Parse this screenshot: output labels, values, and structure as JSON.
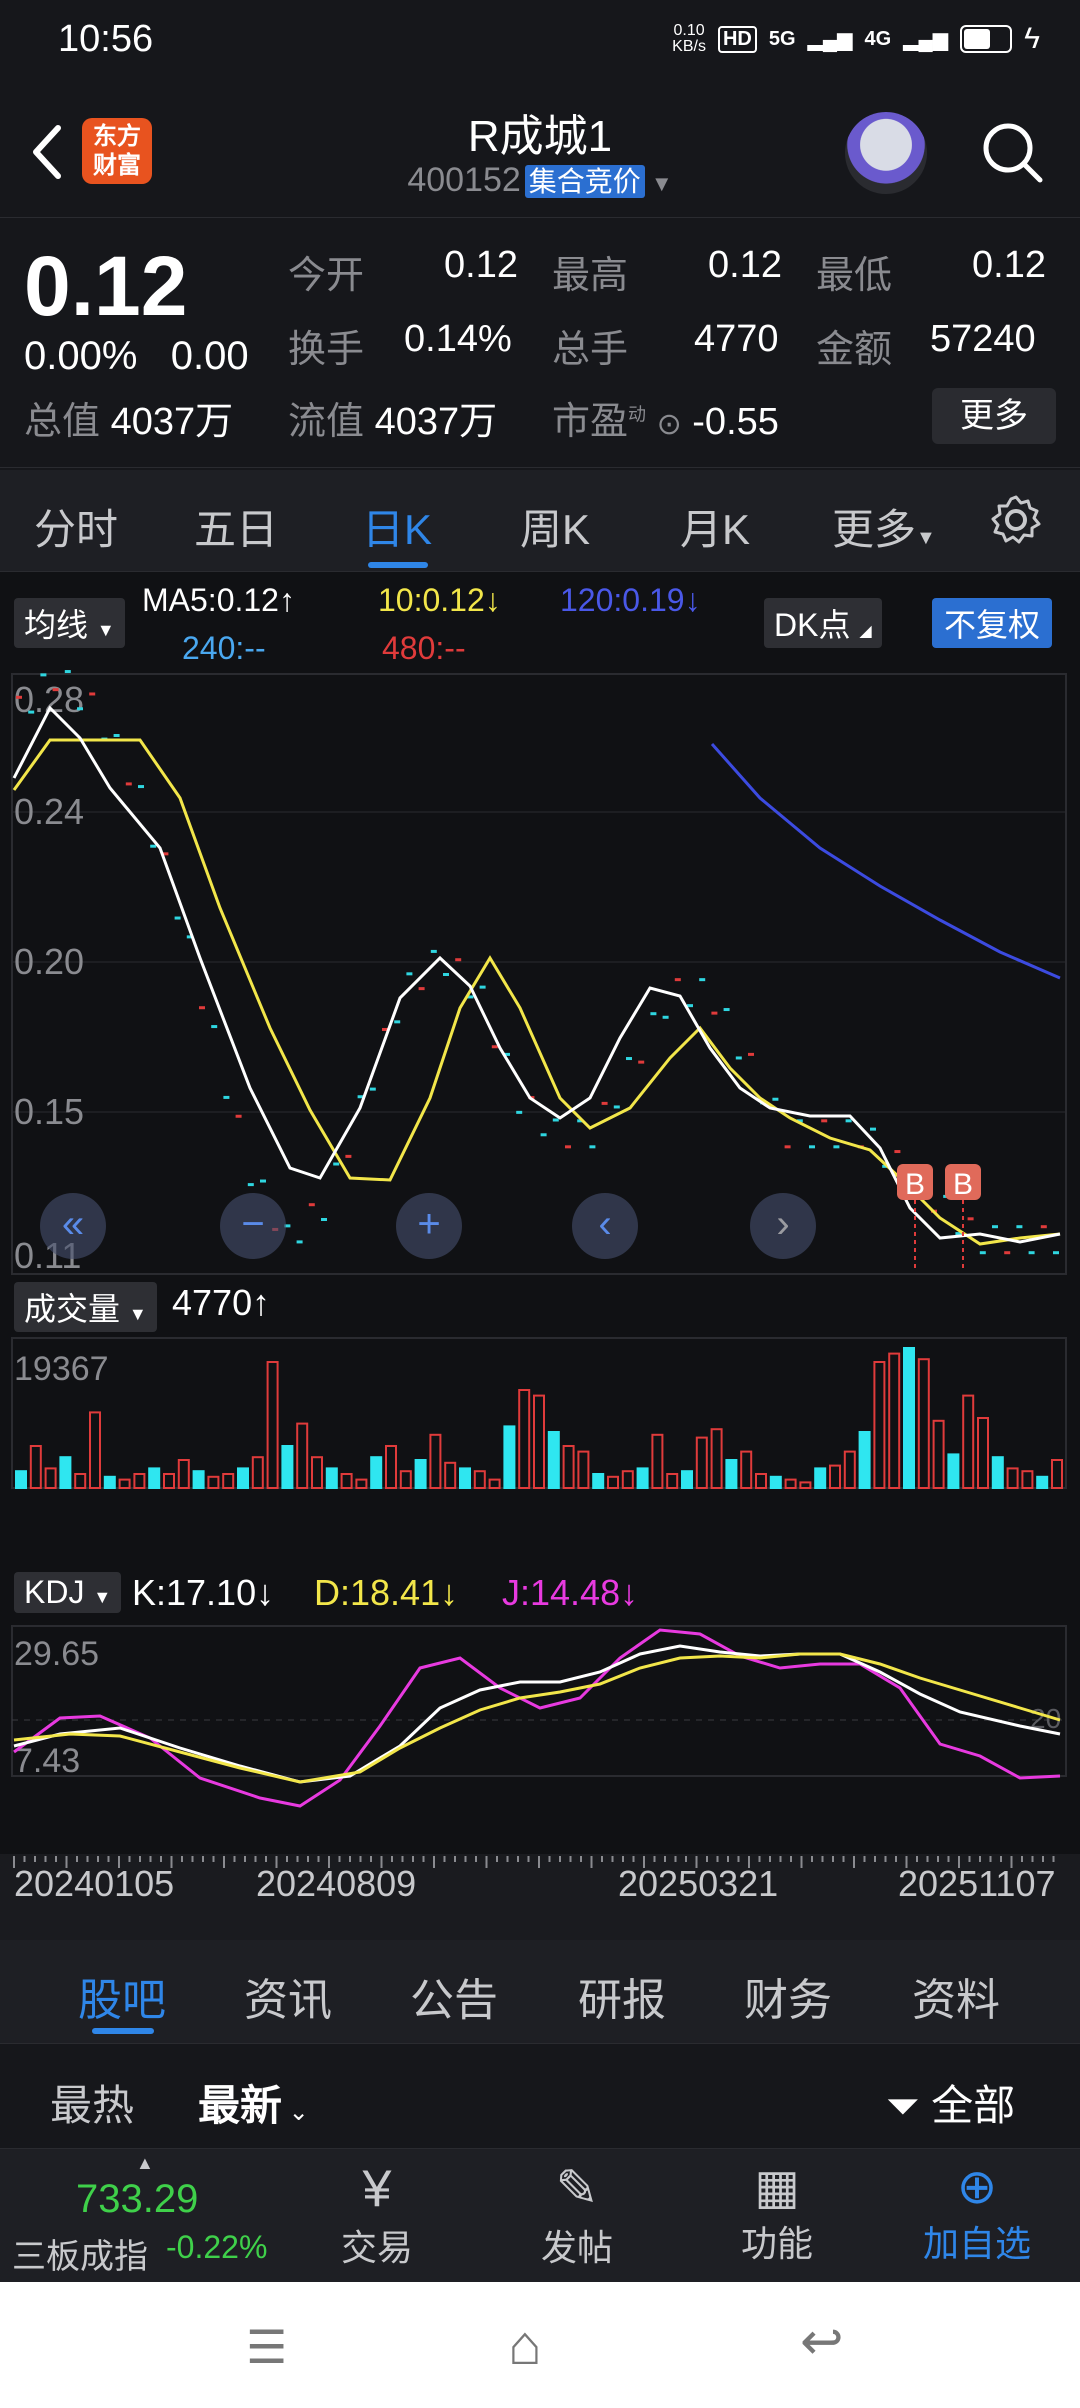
{
  "status": {
    "time": "10:56",
    "net_speed": "0.10",
    "net_unit": "KB/s",
    "hd": "HD",
    "sig1": "5G",
    "sig2": "4G"
  },
  "header": {
    "logo_text_1": "东方",
    "logo_text_2": "财富",
    "title": "R成城1",
    "code": "400152",
    "tag": "集合竞价"
  },
  "quote": {
    "price": "0.12",
    "change_pct": "0.00%",
    "change": "0.00",
    "open_label": "今开",
    "open": "0.12",
    "high_label": "最高",
    "high": "0.12",
    "low_label": "最低",
    "low": "0.12",
    "turnover_label": "换手",
    "turnover": "0.14%",
    "volume_label": "总手",
    "volume": "4770",
    "amount_label": "金额",
    "amount": "57240",
    "mktcap_label": "总值",
    "mktcap": "4037万",
    "float_label": "流值",
    "float": "4037万",
    "pe_label": "市盈",
    "pe_sup": "动",
    "pe": "-0.55",
    "more": "更多"
  },
  "tabs": [
    "分时",
    "五日",
    "日K",
    "周K",
    "月K",
    "更多"
  ],
  "ma": {
    "label": "均线",
    "ma5": "MA5:0.12↑",
    "ma10": "10:0.12↓",
    "ma120": "120:0.19↓",
    "ma240": "240:--",
    "ma480": "480:--",
    "dk": "DK点",
    "fq": "不复权"
  },
  "price_axis": [
    "0.28",
    "0.24",
    "0.20",
    "0.15",
    "0.11"
  ],
  "vol": {
    "label": "成交量",
    "value": "4770↑",
    "max": "19367"
  },
  "kdj": {
    "label": "KDJ",
    "k": "K:17.10↓",
    "d": "D:18.41↓",
    "j": "J:14.48↓",
    "max": "29.65",
    "min": "7.43",
    "ref": "20"
  },
  "dates": [
    "20240105",
    "20240809",
    "20250321",
    "20251107"
  ],
  "markers": [
    "B",
    "B"
  ],
  "bottom_tabs": [
    "股吧",
    "资讯",
    "公告",
    "研报",
    "财务",
    "资料"
  ],
  "sort": {
    "hot": "最热",
    "new": "最新",
    "filter": "全部"
  },
  "index": {
    "value": "733.29",
    "name": "三板成指",
    "chg": "-0.22%"
  },
  "dock": [
    "交易",
    "发帖",
    "功能",
    "加自选"
  ],
  "colors": {
    "up": "#e03b3b",
    "down": "#2fd6e0",
    "ma5": "#ffffff",
    "ma10": "#f2e64a",
    "ma120": "#3c4be0",
    "j": "#e83ae0",
    "accent": "#2f86e8"
  },
  "chart_data": {
    "type": "candlestick",
    "title": "R成城1 日K",
    "ylim": [
      0.11,
      0.28
    ],
    "ma5": [
      0.27,
      0.28,
      0.27,
      0.25,
      0.22,
      0.18,
      0.14,
      0.12,
      0.13,
      0.16,
      0.19,
      0.2,
      0.19,
      0.16,
      0.15,
      0.15,
      0.17,
      0.19,
      0.19,
      0.17,
      0.15,
      0.15,
      0.15,
      0.14,
      0.13,
      0.12,
      0.12,
      0.12
    ],
    "ma10": [
      0.26,
      0.27,
      0.27,
      0.26,
      0.24,
      0.2,
      0.16,
      0.13,
      0.13,
      0.15,
      0.18,
      0.19,
      0.18,
      0.17,
      0.16,
      0.16,
      0.17,
      0.18,
      0.18,
      0.17,
      0.16,
      0.15,
      0.15,
      0.14,
      0.13,
      0.13,
      0.12,
      0.12
    ],
    "ma120": [
      0.27,
      0.26,
      0.25,
      0.24,
      0.23,
      0.22,
      0.21,
      0.2,
      0.19
    ]
  }
}
